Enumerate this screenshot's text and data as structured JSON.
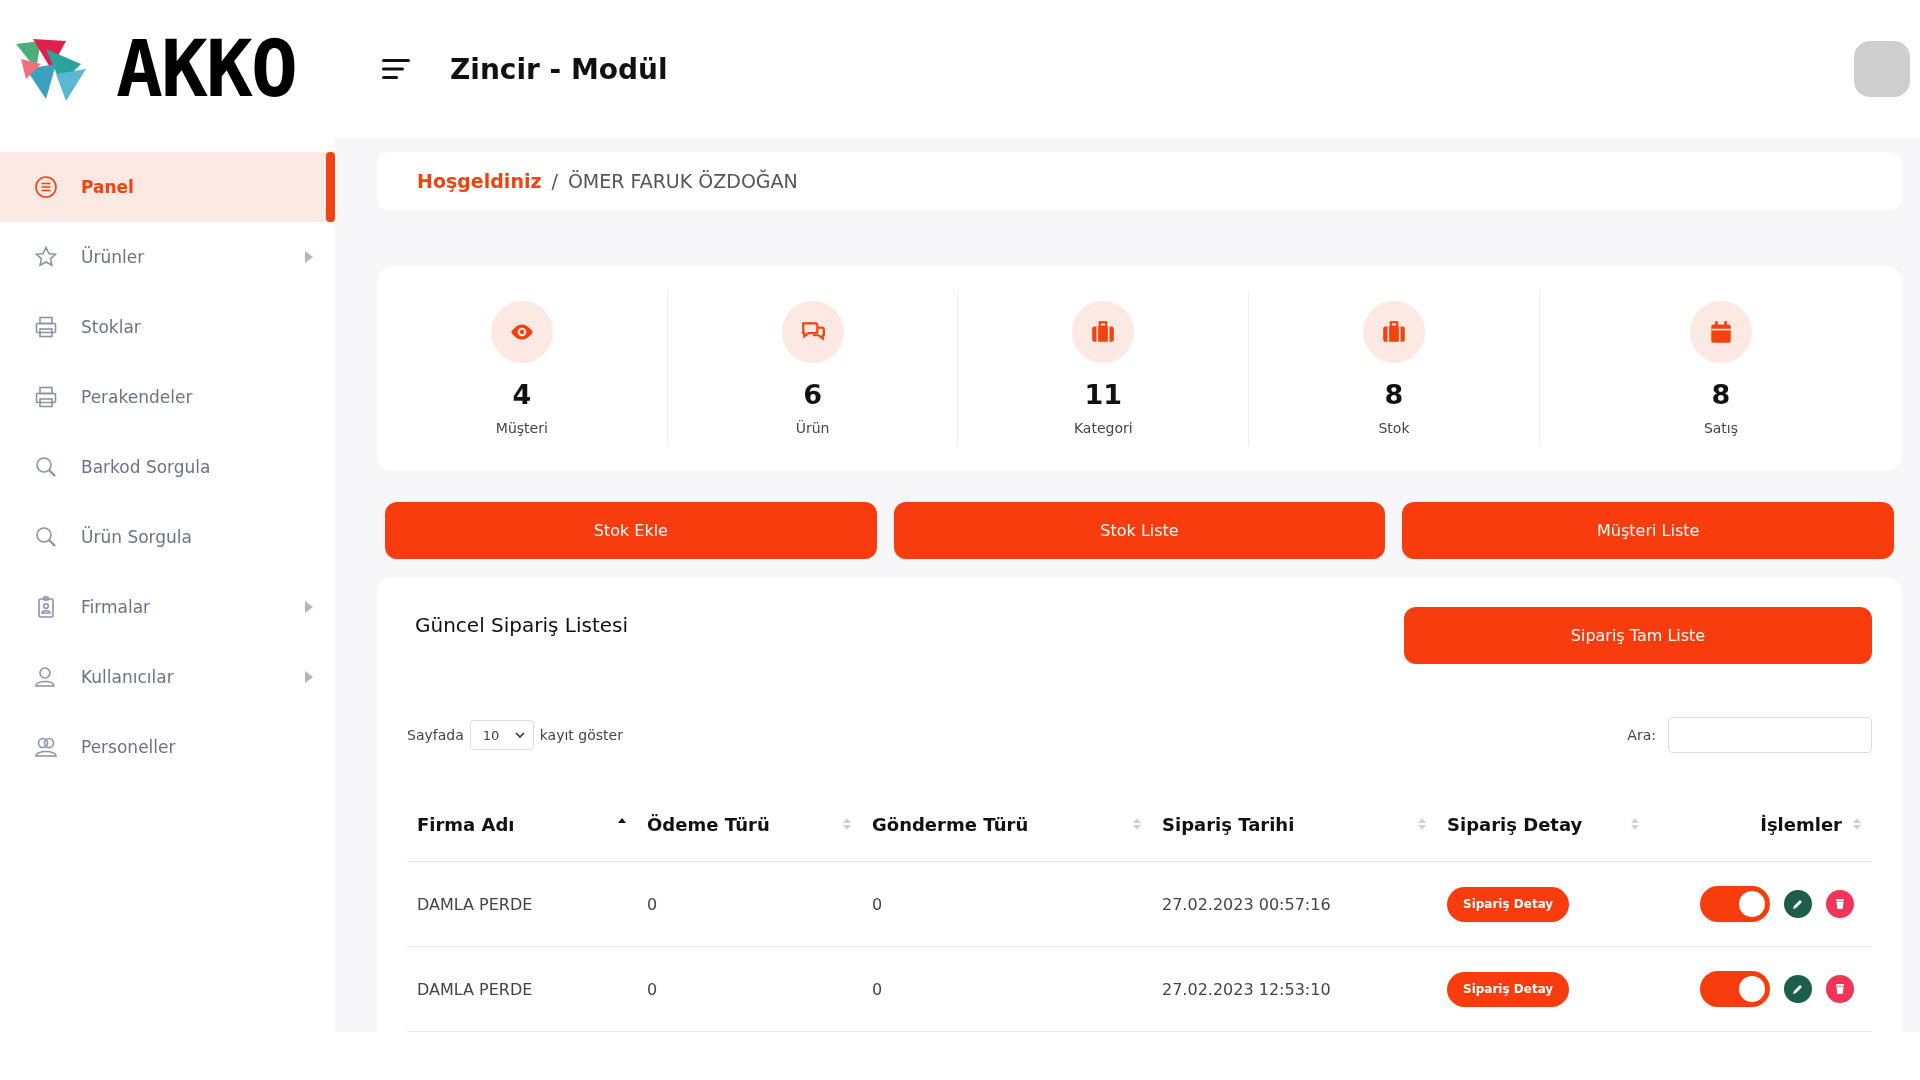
{
  "header": {
    "logo_text": "AKKO",
    "title": "Zincir - Modül"
  },
  "sidebar": {
    "items": [
      {
        "label": "Panel",
        "selected": true,
        "has_submenu": false
      },
      {
        "label": "Ürünler",
        "selected": false,
        "has_submenu": true
      },
      {
        "label": "Stoklar",
        "selected": false,
        "has_submenu": false
      },
      {
        "label": "Perakendeler",
        "selected": false,
        "has_submenu": false
      },
      {
        "label": "Barkod Sorgula",
        "selected": false,
        "has_submenu": false
      },
      {
        "label": "Ürün Sorgula",
        "selected": false,
        "has_submenu": false
      },
      {
        "label": "Firmalar",
        "selected": false,
        "has_submenu": true
      },
      {
        "label": "Kullanıcılar",
        "selected": false,
        "has_submenu": true
      },
      {
        "label": "Personeller",
        "selected": false,
        "has_submenu": false
      }
    ]
  },
  "breadcrumb": {
    "link": "Hoşgeldiniz",
    "separator": "/",
    "current": "ÖMER FARUK ÖZDOĞAN"
  },
  "stats": [
    {
      "value": "4",
      "label": "Müşteri"
    },
    {
      "value": "6",
      "label": "Ürün"
    },
    {
      "value": "11",
      "label": "Kategori"
    },
    {
      "value": "8",
      "label": "Stok"
    },
    {
      "value": "8",
      "label": "Satış"
    }
  ],
  "actions": [
    "Stok Ekle",
    "Stok Liste",
    "Müşteri Liste"
  ],
  "orders": {
    "title": "Güncel Sipariş Listesi",
    "full_list_button": "Sipariş Tam Liste",
    "length_prefix": "Sayfada",
    "length_value": "10",
    "length_suffix": "kayıt göster",
    "search_label": "Ara:",
    "columns": [
      {
        "label": "Firma Adı",
        "sorted": true
      },
      {
        "label": "Ödeme Türü",
        "sorted": false
      },
      {
        "label": "Gönderme Türü",
        "sorted": false
      },
      {
        "label": "Sipariş Tarihi",
        "sorted": false
      },
      {
        "label": "Sipariş Detay",
        "sorted": false
      },
      {
        "label": "İşlemler",
        "sorted": false
      }
    ],
    "rows": [
      {
        "firm": "DAMLA PERDE",
        "payment": "0",
        "shipping": "0",
        "date": "27.02.2023 00:57:16",
        "detail_button": "Sipariş Detay",
        "on": true
      },
      {
        "firm": "DAMLA PERDE",
        "payment": "0",
        "shipping": "0",
        "date": "27.02.2023 12:53:10",
        "detail_button": "Sipariş Detay",
        "on": true
      }
    ]
  }
}
